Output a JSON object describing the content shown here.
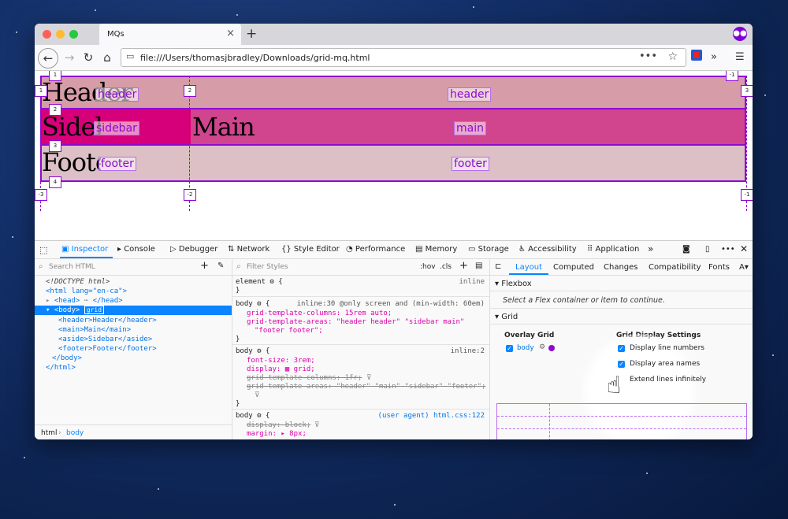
{
  "tab": {
    "title": "MQs",
    "close": "×",
    "new": "+"
  },
  "nav": {
    "url": "file:///Users/thomasjbradley/Downloads/grid-mq.html",
    "page_actions": "•••",
    "bookmark": "☆",
    "overflow": "»",
    "menu": "☰"
  },
  "page": {
    "header_text": "Header",
    "sidebar_text": "Sidebar",
    "main_text": "Main",
    "footer_text": "Footer",
    "area_labels": {
      "header_a": "header",
      "header_b": "header",
      "sidebar": "sidebar",
      "main": "main",
      "footer_a": "footer",
      "footer_b": "footer"
    },
    "line_numbers": {
      "r1": "1",
      "r2": "2",
      "r3": "3",
      "r4": "4",
      "c2": "2",
      "neg1_top": "-1",
      "neg3": "-3",
      "neg2": "-2",
      "neg1_bottom": "-1",
      "right3": "3",
      "left1": "1"
    },
    "colors": {
      "header": "#d69ca8",
      "sidebar": "#d6007a",
      "main": "#d1448e",
      "footer": "#dcc0c5",
      "grid_line": "#8d0ad2"
    }
  },
  "devtools": {
    "tabs": [
      "Inspector",
      "Console",
      "Debugger",
      "Network",
      "Style Editor",
      "Performance",
      "Memory",
      "Storage",
      "Accessibility",
      "Application"
    ],
    "active_tab": "Inspector",
    "search_placeholder": "Search HTML",
    "filter_placeholder": "Filter Styles",
    "hov": ":hov",
    "cls": ".cls",
    "markup": {
      "doctype": "<!DOCTYPE html>",
      "html_open": "<html lang=\"en-ca\">",
      "head": "<head>",
      "head_close": "</head>",
      "body_open": "<body>",
      "grid_badge": "grid",
      "header_line": "<header>Header</header>",
      "main_line": "<main>Main</main>",
      "aside_line": "<aside>Sidebar</aside>",
      "footer_line": "<footer>Footer</footer>",
      "body_close": "</body>",
      "html_close": "</html>"
    },
    "breadcrumb": [
      "html",
      "body"
    ],
    "rules": {
      "element_sel": "element",
      "element_src": "inline",
      "body1_sel": "body",
      "body1_src": "inline:30 @only screen and (min-width: 60em)",
      "body1_p1": "grid-template-columns: 15rem auto;",
      "body1_p2": "grid-template-areas: \"header header\" \"sidebar main\"",
      "body1_p2b": "\"footer footer\";",
      "body2_sel": "body",
      "body2_src": "inline:2",
      "body2_p1": "font-size: 3rem;",
      "body2_p2": "display: ▦ grid;",
      "body2_p3": "grid-template-columns: 1fr;",
      "body2_p4": "grid-template-areas: \"header\" \"main\" \"sidebar\" \"footer\";",
      "body3_sel": "body",
      "body3_src": "(user agent) html.css:122",
      "body3_p1": "display: block;",
      "body3_p2": "margin: ▸ 8px;",
      "open_brace": "{",
      "close_brace": "}"
    },
    "layout_tabs": [
      "Layout",
      "Computed",
      "Changes",
      "Compatibility",
      "Fonts"
    ],
    "flexbox_title": "Flexbox",
    "flexbox_hint": "Select a Flex container or item to continue.",
    "grid_title": "Grid",
    "overlay_grid": "Overlay Grid",
    "overlay_item": "body",
    "display_settings": "Grid Display Settings",
    "settings": [
      "Display line numbers",
      "Display area names",
      "Extend lines infinitely"
    ]
  }
}
